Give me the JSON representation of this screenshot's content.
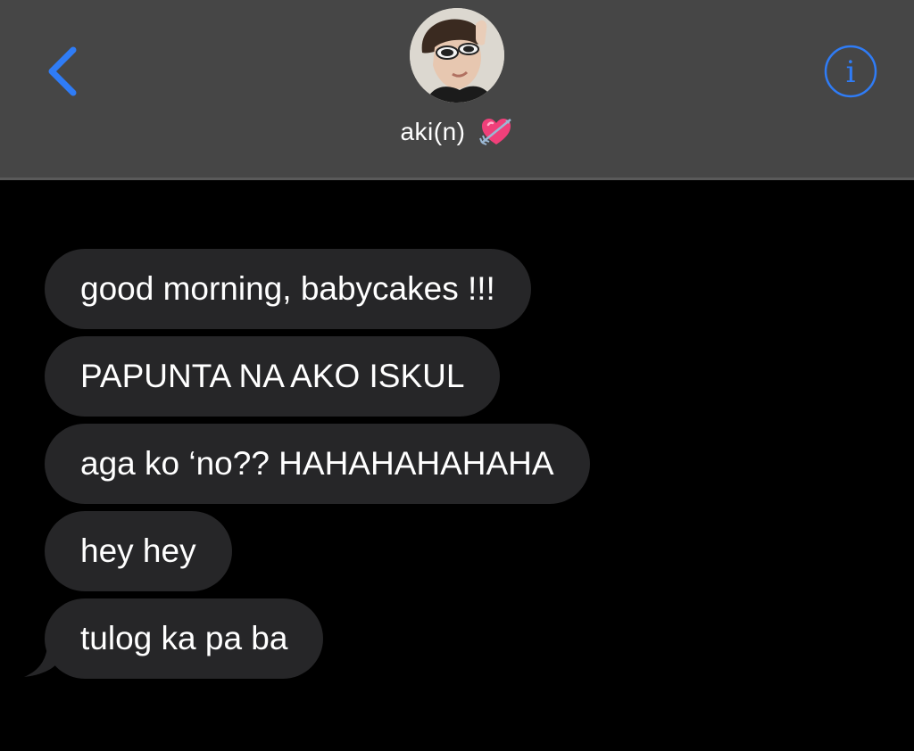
{
  "header": {
    "back_icon": "chevron-left-icon",
    "info_icon": "info-icon",
    "info_glyph": "i",
    "contact_name": "aki(n)",
    "contact_emoji": "heart-with-arrow-icon",
    "accent_color": "#2f7cf6",
    "background_color": "#464646"
  },
  "messages": [
    {
      "text": "good morning, babycakes !!!",
      "direction": "incoming"
    },
    {
      "text": "PAPUNTA NA AKO ISKUL",
      "direction": "incoming"
    },
    {
      "text": "aga ko ‘no?? HAHAHAHAHAHA",
      "direction": "incoming"
    },
    {
      "text": "hey hey",
      "direction": "incoming"
    },
    {
      "text": "tulog ka pa ba",
      "direction": "incoming"
    }
  ],
  "colors": {
    "bubble": "#262628",
    "background": "#000000",
    "text": "#ffffff"
  }
}
